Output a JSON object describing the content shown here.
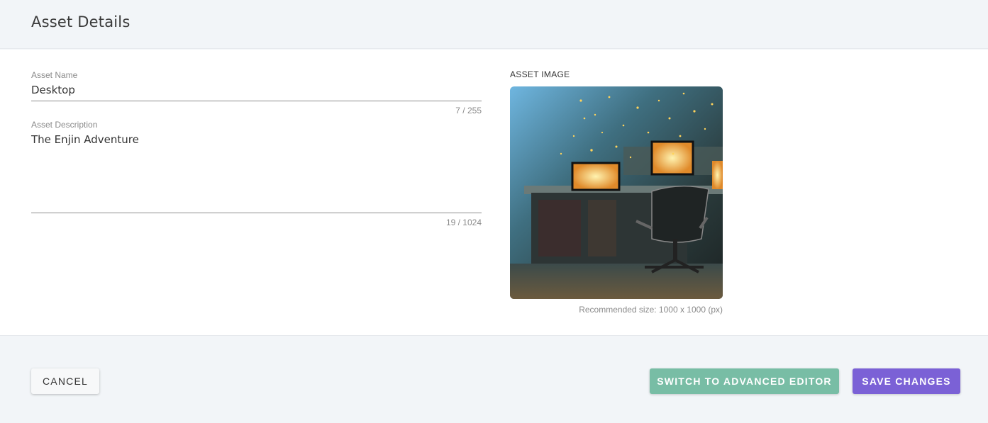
{
  "header": {
    "title": "Asset Details"
  },
  "form": {
    "name": {
      "label": "Asset Name",
      "value": "Desktop",
      "counter": "7 / 255"
    },
    "description": {
      "label": "Asset Description",
      "value": "The Enjin Adventure",
      "counter": "19 / 1024"
    }
  },
  "image": {
    "label": "ASSET IMAGE",
    "note": "Recommended size: 1000 x 1000 (px)",
    "icon": "asset-image-preview"
  },
  "footer": {
    "cancel_label": "CANCEL",
    "advanced_label": "SWITCH TO ADVANCED EDITOR",
    "save_label": "SAVE CHANGES"
  },
  "colors": {
    "advanced_button": "#78bda5",
    "save_button": "#7b61d6",
    "page_background": "#f2f5f8"
  }
}
